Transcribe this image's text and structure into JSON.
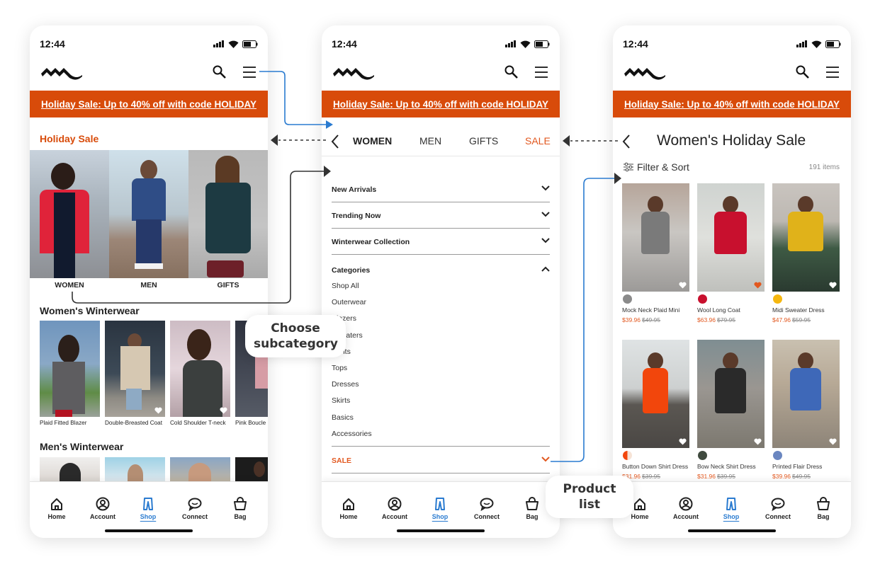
{
  "status": {
    "time": "12:44"
  },
  "promo": {
    "text": "Holiday Sale: Up to 40% off with code HOLIDAY"
  },
  "colors": {
    "brand_orange": "#d84b0a",
    "sale_orange": "#e2581f",
    "active_blue": "#2a7bd0",
    "arrow_blue": "#2a7bd0",
    "text_dark": "#222222"
  },
  "screen1": {
    "section_title": "Holiday Sale",
    "hero_categories": [
      {
        "label": "WOMEN"
      },
      {
        "label": "MEN"
      },
      {
        "label": "GIFTS"
      }
    ],
    "womens_title": "Women's Winterwear",
    "womens_items": [
      {
        "name": "Plaid Fitted Blazer"
      },
      {
        "name": "Double-Breasted Coat"
      },
      {
        "name": "Cold Shoulder T-neck"
      },
      {
        "name": "Pink Boucle"
      }
    ],
    "mens_title": "Men's Winterwear"
  },
  "screen2": {
    "tabs": [
      {
        "label": "WOMEN"
      },
      {
        "label": "MEN"
      },
      {
        "label": "GIFTS"
      },
      {
        "label": "SALE"
      }
    ],
    "accordions": [
      {
        "label": "New Arrivals"
      },
      {
        "label": "Trending Now"
      },
      {
        "label": "Winterwear Collection"
      }
    ],
    "categories_label": "Categories",
    "categories": [
      "Shop All",
      "Outerwear",
      "Blazers",
      "Sweaters",
      "Pants",
      "Tops",
      "Dresses",
      "Skirts",
      "Basics",
      "Accessories"
    ],
    "sale_label": "SALE"
  },
  "screen3": {
    "title": "Women's Holiday Sale",
    "filter_label": "Filter & Sort",
    "item_count": "191 items",
    "products": [
      {
        "name": "Mock Neck Plaid Mini",
        "sale_price": "$39.96",
        "orig_price": "$49.95",
        "swatch": "#8a8a8a",
        "favorited": false
      },
      {
        "name": "Wool Long Coat",
        "sale_price": "$63.96",
        "orig_price": "$79.95",
        "swatch": "#c8102e",
        "favorited": true
      },
      {
        "name": "Midi Sweater Dress",
        "sale_price": "$47.96",
        "orig_price": "$59.95",
        "swatch": "#f5b70f",
        "favorited": false
      },
      {
        "name": "Button Down Shirt Dress",
        "sale_price": "$31.96",
        "orig_price": "$39.95",
        "swatch": "#f2460c",
        "favorited": false
      },
      {
        "name": "Bow Neck Shirt Dress",
        "sale_price": "$31.96",
        "orig_price": "$39.95",
        "swatch": "#3f4a3e",
        "favorited": false
      },
      {
        "name": "Printed Flair Dress",
        "sale_price": "$39.96",
        "orig_price": "$49.95",
        "swatch": "#6a86c0",
        "favorited": false
      }
    ]
  },
  "tabbar": [
    {
      "label": "Home",
      "icon": "home-icon"
    },
    {
      "label": "Account",
      "icon": "account-icon"
    },
    {
      "label": "Shop",
      "icon": "shop-icon",
      "active": true
    },
    {
      "label": "Connect",
      "icon": "chat-icon"
    },
    {
      "label": "Bag",
      "icon": "bag-icon"
    }
  ],
  "callouts": {
    "subcategory": "Choose subcategory",
    "product_list": "Product list"
  }
}
